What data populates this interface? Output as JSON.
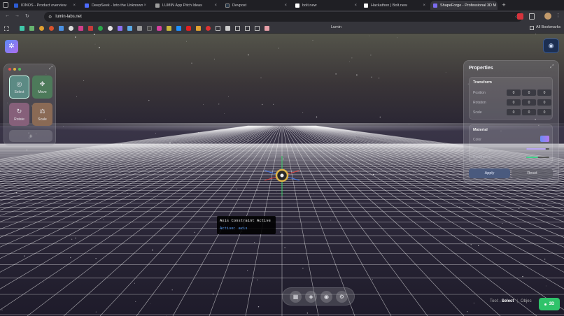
{
  "browser": {
    "tabs": [
      {
        "label": "IONOS - Product overview",
        "color": "#2d5cd3"
      },
      {
        "label": "DeepSeek - Into the Unknown",
        "color": "#4d6bfe"
      },
      {
        "label": "LUMIN App Pitch Ideas",
        "color": "#9d9d9d"
      },
      {
        "label": "Devpost",
        "color": "#2b3b4b"
      },
      {
        "label": "bolt.new",
        "color": "#ffffff"
      },
      {
        "label": "Hackathon | Bolt.new",
        "color": "#ffffff"
      },
      {
        "label": "ShapeForge - Professional 3D M",
        "color": "#7b6cf0"
      }
    ],
    "url": "lumin-labs.net",
    "bookmark_label": "Lumin",
    "all_bookmarks": "All Bookmarks"
  },
  "tools": {
    "items": [
      {
        "label": "Select",
        "icon": "◎"
      },
      {
        "label": "Move",
        "icon": "✥"
      },
      {
        "label": "Rotate",
        "icon": "↻"
      },
      {
        "label": "Scale",
        "icon": "⚖"
      }
    ],
    "add_icon": "+"
  },
  "properties": {
    "title": "Properties",
    "transform": {
      "title": "Transform",
      "rows": [
        {
          "label": "Position",
          "values": [
            "0",
            "0",
            "0"
          ]
        },
        {
          "label": "Rotation",
          "values": [
            "0",
            "0",
            "0"
          ]
        },
        {
          "label": "Scale",
          "values": [
            "0",
            "0",
            "0"
          ]
        }
      ]
    },
    "material": {
      "title": "Material",
      "color_label": "Color",
      "opacity_label": "Opacity",
      "opacity_value": 0.85,
      "roughness_label": "Roughness",
      "roughness_value": 0.5
    },
    "apply_label": "Apply",
    "reset_label": "Reset"
  },
  "tooltip": {
    "title": "Axis Constraint Active",
    "detail": "Active: axis"
  },
  "status": {
    "tool_label": "Tool:",
    "tool_value": "Select",
    "separator": "|",
    "objects_label": "Objec",
    "mode_badge": "3D"
  },
  "colors": {
    "accent": "#7b6cf0",
    "mode_badge": "#2fc36a",
    "tooltip_text": "#5aa2ff"
  }
}
